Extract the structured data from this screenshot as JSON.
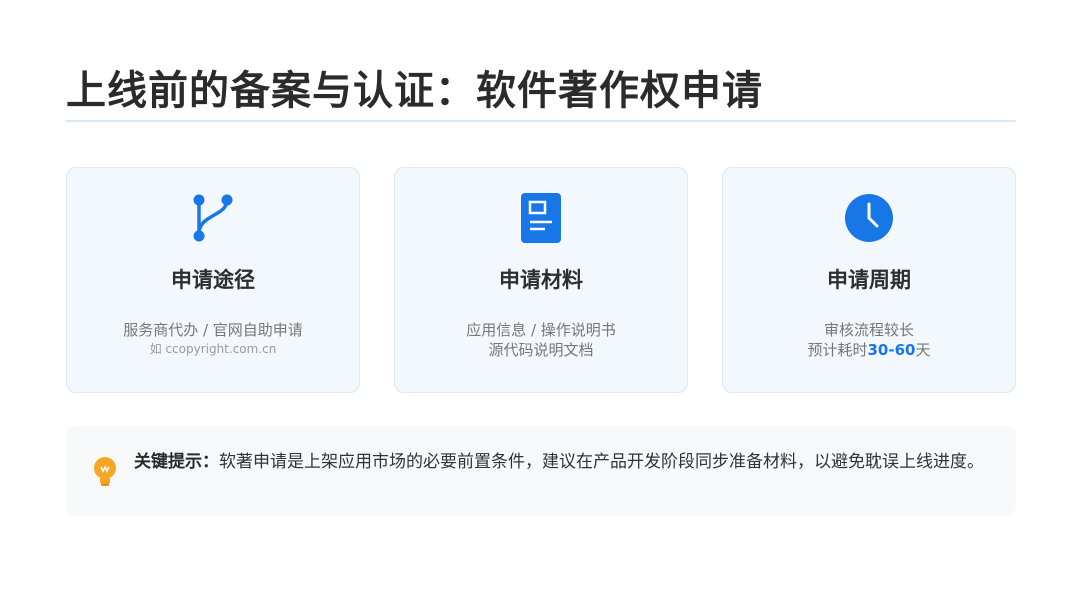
{
  "title": "上线前的备案与认证：软件著作权申请",
  "cards": [
    {
      "icon": "branch-icon",
      "title": "申请途径",
      "line1": "服务商代办 / 官网自助申请",
      "line2": "如 ccopyright.com.cn"
    },
    {
      "icon": "document-icon",
      "title": "申请材料",
      "line1": "应用信息 / 操作说明书",
      "line2": "源代码说明文档"
    },
    {
      "icon": "clock-icon",
      "title": "申请周期",
      "line1": "审核流程较长",
      "line2_prefix": "预计耗时",
      "line2_highlight": "30-60",
      "line2_suffix": "天"
    }
  ],
  "tip": {
    "icon": "lightbulb-icon",
    "label": "关键提示：",
    "text": "软著申请是上架应用市场的必要前置条件，建议在产品开发阶段同步准备材料，以避免耽误上线进度。"
  },
  "colors": {
    "accent": "#1877e6",
    "card_bg": "#f2f8fe",
    "tip_icon": "#f5a623"
  }
}
